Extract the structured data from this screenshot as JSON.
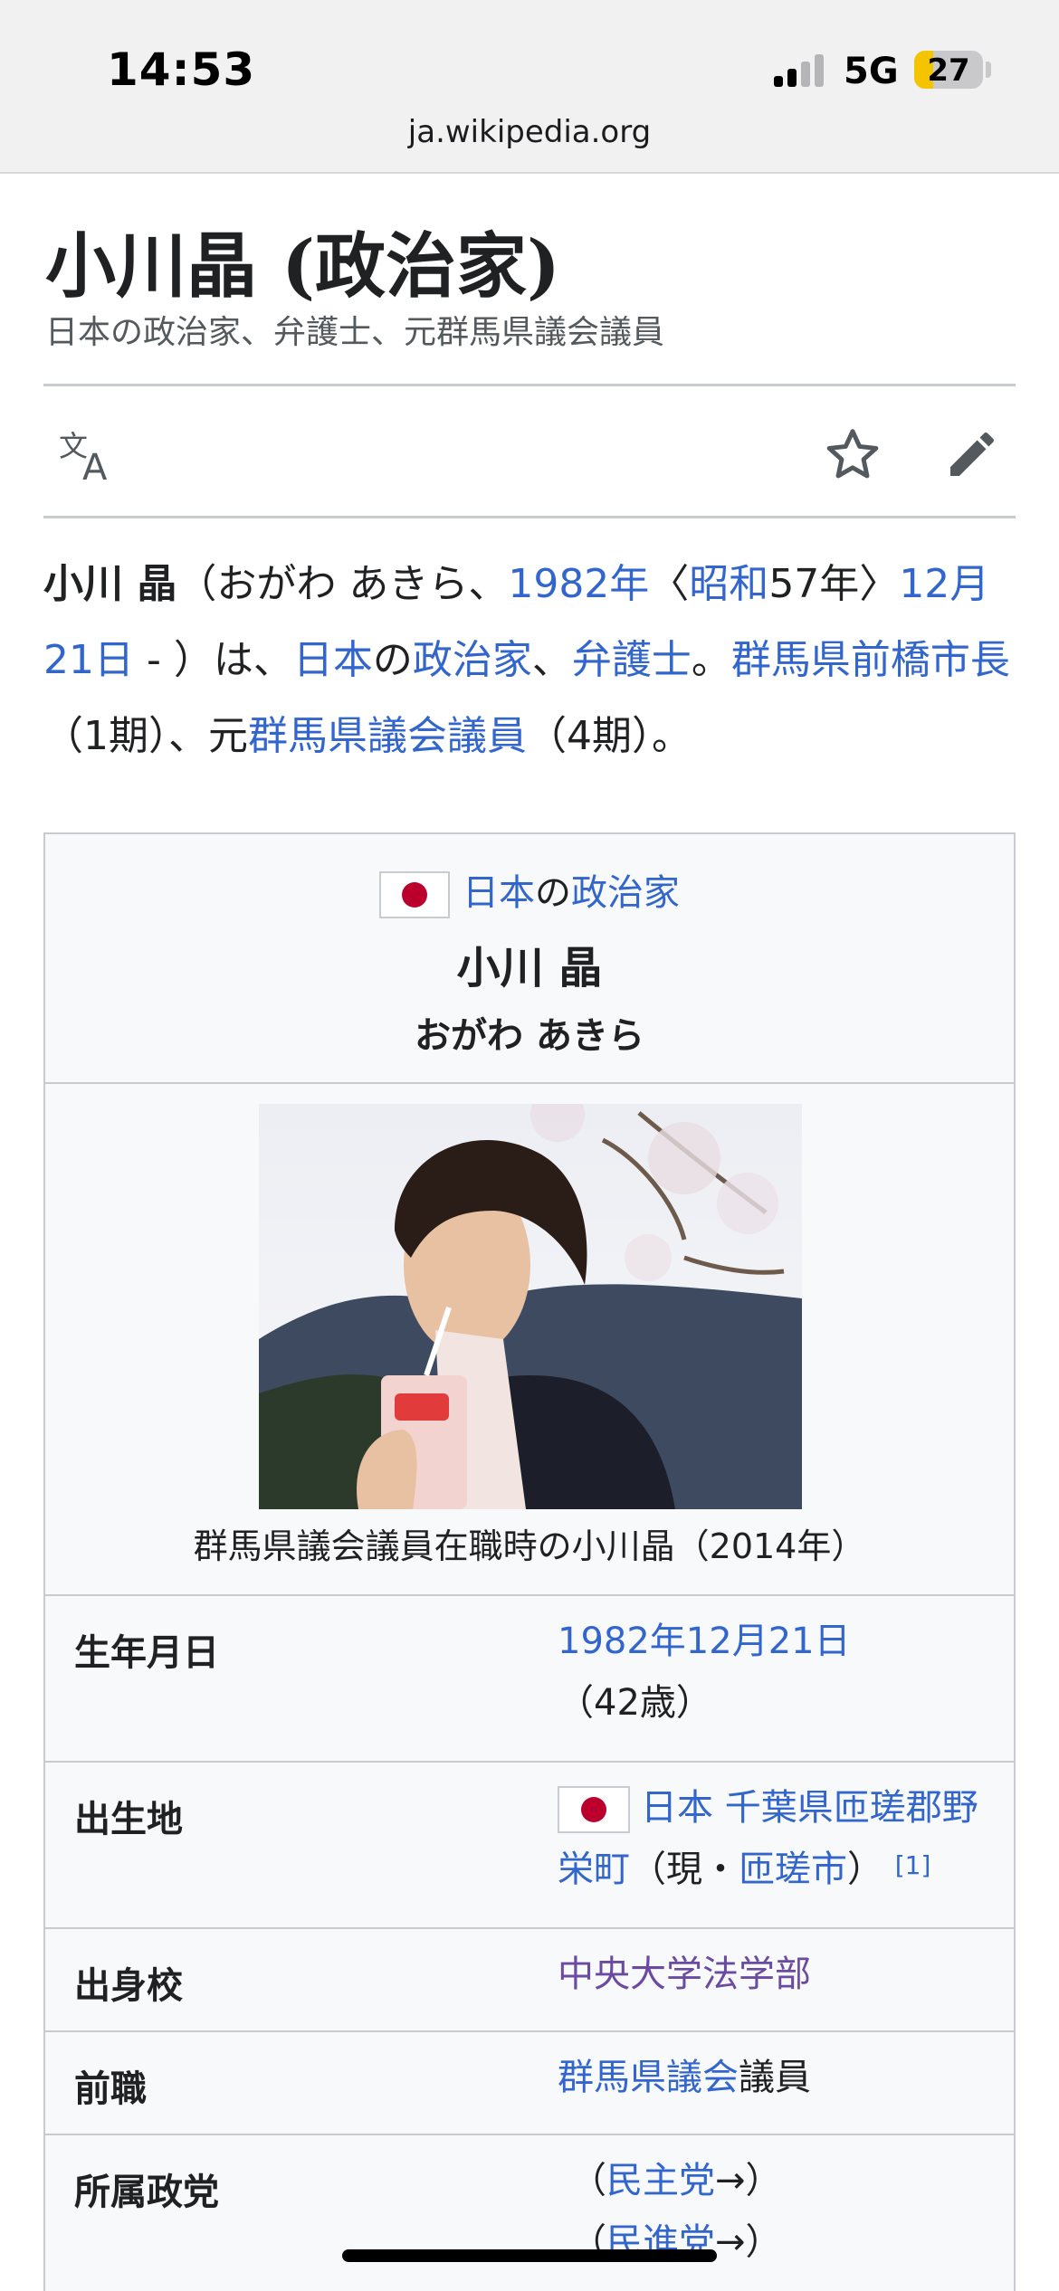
{
  "status_bar": {
    "time": "14:53",
    "network": "5G",
    "battery": "27",
    "url": "ja.wikipedia.org"
  },
  "article": {
    "title": "小川晶 (政治家)",
    "subtitle": "日本の政治家、弁護士、元群馬県議会議員",
    "icons": [
      "translate-icon",
      "star-icon",
      "edit-pencil-icon"
    ]
  },
  "lead": {
    "name_bold": "小川 晶",
    "t1": "（おがわ あきら、",
    "l_year": "1982年",
    "t2": "〈",
    "l_showa": "昭和",
    "t3": "57年〉",
    "l_date": "12月21日",
    "t4": " - ）は、",
    "l_japan": "日本",
    "t5": "の",
    "l_politician": "政治家",
    "t6": "、",
    "l_lawyer": "弁護士",
    "t7": "。",
    "l_mayor": "群馬県前橋市長",
    "t8": "（1期）、元",
    "l_assembly": "群馬県議会議員",
    "t9": "（4期）。"
  },
  "infobox": {
    "cat_link1": "日本",
    "cat_mid": "の",
    "cat_link2": "政治家",
    "name": "小川 晶",
    "kana": "おがわ あきら",
    "caption": "群馬県議会議員在職時の小川晶（2014年）",
    "rows": {
      "birth": {
        "label": "生年月日",
        "link": "1982年12月21日",
        "rest": "（42歳）"
      },
      "birthplace": {
        "label": "出生地",
        "link1": "日本",
        "link2": "千葉県匝瑳郡野栄町",
        "t1": "（現・",
        "link3": "匝瑳市",
        "t2": "）",
        "ref": "[1]"
      },
      "school": {
        "label": "出身校",
        "link": "中央大学法学部"
      },
      "prev": {
        "label": "前職",
        "link": "群馬県議会",
        "rest": "議員"
      },
      "party": {
        "label": "所属政党",
        "line1_pre": "（",
        "line1_link": "民主党",
        "line1_post": "→）",
        "line2_pre": "（",
        "line2_link": "民進党",
        "line2_post": "→）"
      }
    }
  },
  "colors": {
    "link": "#3366cc",
    "visited": "#6b4ba1",
    "text": "#202122",
    "flag_red": "#bc002d"
  }
}
